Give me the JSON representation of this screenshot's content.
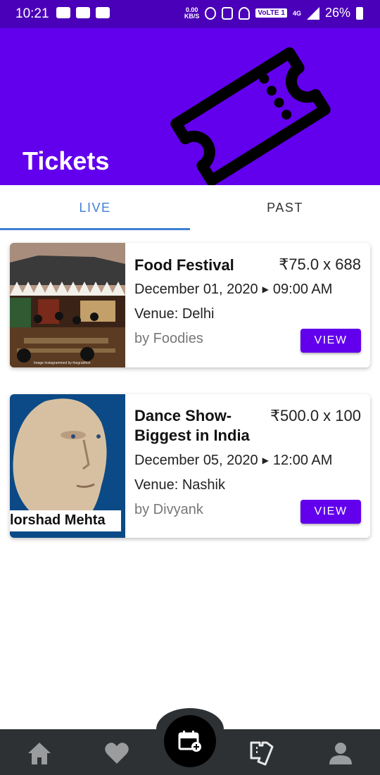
{
  "status_bar": {
    "time": "10:21",
    "net_speed_value": "0.00",
    "net_speed_unit": "KB/S",
    "volte": "VoLTE 1",
    "network": "4G",
    "battery": "26%"
  },
  "header": {
    "title": "Tickets",
    "background_color": "#6200ee",
    "art_icon": "ticket-icon"
  },
  "tabs": [
    {
      "label": "LIVE",
      "selected": true
    },
    {
      "label": "PAST",
      "selected": false
    }
  ],
  "tickets": [
    {
      "name": "Food Festival",
      "price": "₹75.0 x 688",
      "date": "December 01, 2020",
      "time": "09:00 AM",
      "venue": "Venue: Delhi",
      "organizer": "by Foodies",
      "button": "VIEW",
      "image_caption": "Image Instagrammed by thegrubfest"
    },
    {
      "name": "Dance Show- Biggest in India",
      "price": "₹500.0 x 100",
      "date": "December 05, 2020",
      "time": "12:00 AM",
      "venue": "Venue: Nashik",
      "organizer": "by Divyank",
      "button": "VIEW",
      "image_caption": "lorshad Mehta"
    }
  ],
  "bottom_nav": {
    "items": [
      "home-icon",
      "heart-icon",
      "calendar-add-icon",
      "tickets-icon",
      "profile-icon"
    ],
    "background_color": "#2e3133"
  },
  "accent_color": "#6200ee",
  "tab_accent_color": "#3f7fd6"
}
